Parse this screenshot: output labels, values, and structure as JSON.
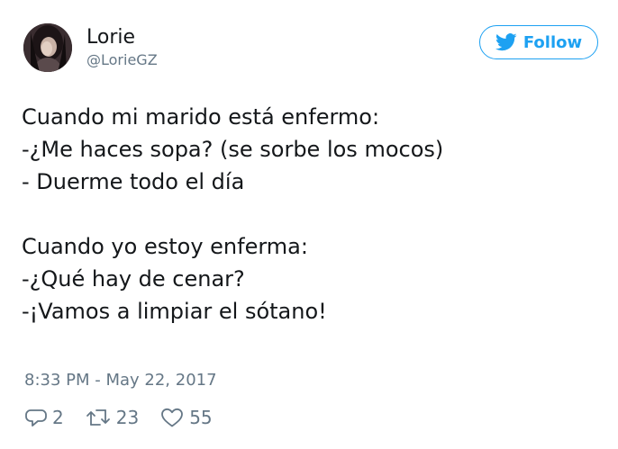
{
  "user": {
    "display_name": "Lorie",
    "handle": "@LorieGZ"
  },
  "follow_button": {
    "label": "Follow"
  },
  "tweet": {
    "lines": [
      "Cuando mi marido está enfermo:",
      "-¿Me haces sopa? (se sorbe los mocos)",
      "- Duerme todo el día",
      "Cuando yo estoy enferma:",
      "-¿Qué hay de cenar?",
      "-¡Vamos a limpiar el sótano!"
    ],
    "timestamp": "8:33 PM - May 22, 2017"
  },
  "actions": {
    "replies": "2",
    "retweets": "23",
    "likes": "55"
  },
  "icons": {
    "follow": "twitter-bird-icon",
    "reply": "reply-icon",
    "retweet": "retweet-icon",
    "like": "heart-icon"
  },
  "colors": {
    "accent": "#1da1f2",
    "text": "#14171a",
    "secondary": "#657786"
  }
}
